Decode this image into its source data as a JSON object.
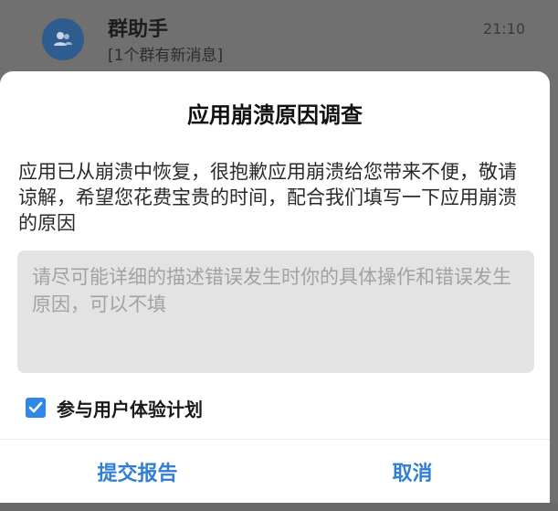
{
  "background": {
    "chat_title": "群助手",
    "chat_preview": "[1个群有新消息]",
    "chat_time": "21:10",
    "avatar_icon": "group-chat-icon"
  },
  "dialog": {
    "title": "应用崩溃原因调查",
    "message": "应用已从崩溃中恢复，很抱歉应用崩溃给您带来不便，敬请谅解，希望您花费宝贵的时间，配合我们填写一下应用崩溃的原因",
    "input_placeholder": "请尽可能详细的描述错误发生时你的具体操作和错误发生原因，可以不填",
    "input_value": "",
    "checkbox_label": "参与用户体验计划",
    "checkbox_checked": true,
    "submit_label": "提交报告",
    "cancel_label": "取消"
  },
  "colors": {
    "accent": "#2f7fd4",
    "checkbox": "#2f88e6",
    "input_bg": "#e3e3e3",
    "overlay": "#707070"
  }
}
